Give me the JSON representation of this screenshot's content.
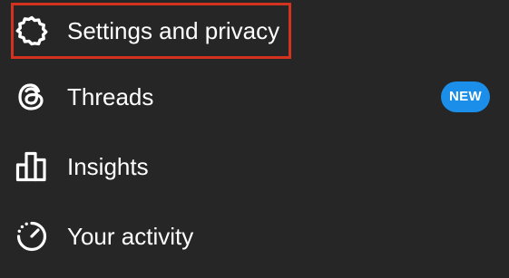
{
  "menu": {
    "items": [
      {
        "label": "Settings and privacy",
        "icon": "gear-icon",
        "highlighted": true
      },
      {
        "label": "Threads",
        "icon": "threads-icon",
        "badge": "NEW"
      },
      {
        "label": "Insights",
        "icon": "insights-bar-chart-icon"
      },
      {
        "label": "Your activity",
        "icon": "activity-timer-icon"
      }
    ]
  },
  "colors": {
    "background": "#262626",
    "text": "#ffffff",
    "highlight_border": "#d3321f",
    "badge_background": "#1a8ee8"
  }
}
